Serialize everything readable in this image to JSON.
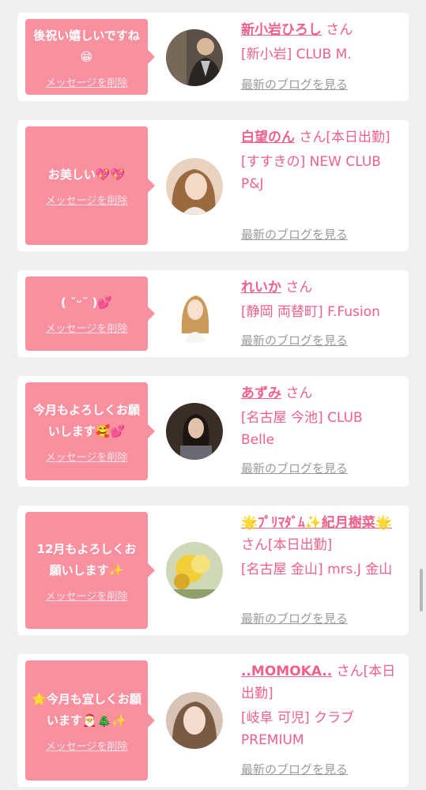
{
  "delete_label": "メッセージを削除",
  "blog_label": "最新のブログを見る",
  "colors": {
    "accent": "#f0608a",
    "bubble": "#f9909f"
  },
  "cards": [
    {
      "message": "後祝い嬉しいですね😁",
      "name": "新小岩ひろし",
      "suffix": "さん",
      "shop": "[新小岩] CLUB M."
    },
    {
      "message": "お美しい💖💖",
      "name": "白望のん",
      "suffix": "さん[本日出勤]",
      "shop": "[すすきの] NEW CLUB P&J"
    },
    {
      "message": "( ˘ᵕ˘ )💕",
      "name": "れいか",
      "suffix": "さん",
      "shop": "[静岡 両替町] F.Fusion"
    },
    {
      "message": "今月もよろしくお願いします🥰💕",
      "name": "あずみ",
      "suffix": "さん",
      "shop": "[名古屋 今池] CLUB Belle"
    },
    {
      "message": "12月もよろしくお願いします✨",
      "name": "🌟ﾌﾟﾘﾏﾀﾞﾑ✨紀月樹菜🌟",
      "suffix": "さん[本日出勤]",
      "shop": "[名古屋 金山] mrs.J 金山"
    },
    {
      "message": "🌟今月も宜しくお願います🎅🎄✨",
      "name": "..MOMOKA..",
      "suffix": "さん[本日出勤]",
      "shop": "[岐阜 可児] クラブ PREMIUM"
    }
  ]
}
